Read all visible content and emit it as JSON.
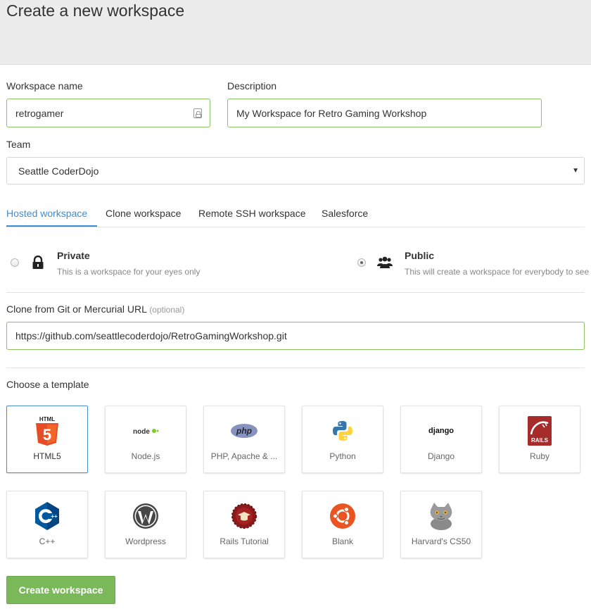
{
  "header": {
    "title": "Create a new workspace"
  },
  "form": {
    "workspace_name": {
      "label": "Workspace name",
      "value": "retrogamer"
    },
    "description": {
      "label": "Description",
      "value": "My Workspace for Retro Gaming Workshop"
    },
    "team": {
      "label": "Team",
      "selected": "Seattle CoderDojo"
    }
  },
  "tabs": [
    {
      "label": "Hosted workspace",
      "active": true
    },
    {
      "label": "Clone workspace",
      "active": false
    },
    {
      "label": "Remote SSH workspace",
      "active": false
    },
    {
      "label": "Salesforce",
      "active": false
    }
  ],
  "visibility": {
    "private": {
      "title": "Private",
      "desc": "This is a workspace for your eyes only",
      "icon": "lock-icon",
      "checked": false
    },
    "public": {
      "title": "Public",
      "desc": "This will create a workspace for everybody to see",
      "icon": "users-icon",
      "checked": true
    }
  },
  "clone": {
    "label": "Clone from Git or Mercurial URL",
    "optional": "(optional)",
    "value": "https://github.com/seattlecoderdojo/RetroGamingWorkshop.git"
  },
  "templates": {
    "heading": "Choose a template",
    "items": [
      {
        "label": "HTML5",
        "icon": "html5-icon",
        "selected": true
      },
      {
        "label": "Node.js",
        "icon": "nodejs-icon",
        "selected": false
      },
      {
        "label": "PHP, Apache & ...",
        "icon": "php-icon",
        "selected": false
      },
      {
        "label": "Python",
        "icon": "python-icon",
        "selected": false
      },
      {
        "label": "Django",
        "icon": "django-icon",
        "selected": false
      },
      {
        "label": "Ruby",
        "icon": "rails-icon",
        "selected": false
      },
      {
        "label": "C++",
        "icon": "cpp-icon",
        "selected": false
      },
      {
        "label": "Wordpress",
        "icon": "wordpress-icon",
        "selected": false
      },
      {
        "label": "Rails Tutorial",
        "icon": "rails-tutorial-icon",
        "selected": false
      },
      {
        "label": "Blank",
        "icon": "ubuntu-icon",
        "selected": false
      },
      {
        "label": "Harvard's CS50",
        "icon": "cat-icon",
        "selected": false
      }
    ]
  },
  "icon_text": {
    "html5_badge": "HTML",
    "html5_glyph": "5",
    "node": "node",
    "php": "php",
    "django": "django",
    "rails": "RAILS",
    "cpp": "C",
    "cpp_plus": "++"
  },
  "actions": {
    "create_label": "Create workspace"
  },
  "colors": {
    "accent": "#3b8dd4",
    "primary_button": "#7bb85a",
    "input_border": "#8cc165"
  }
}
